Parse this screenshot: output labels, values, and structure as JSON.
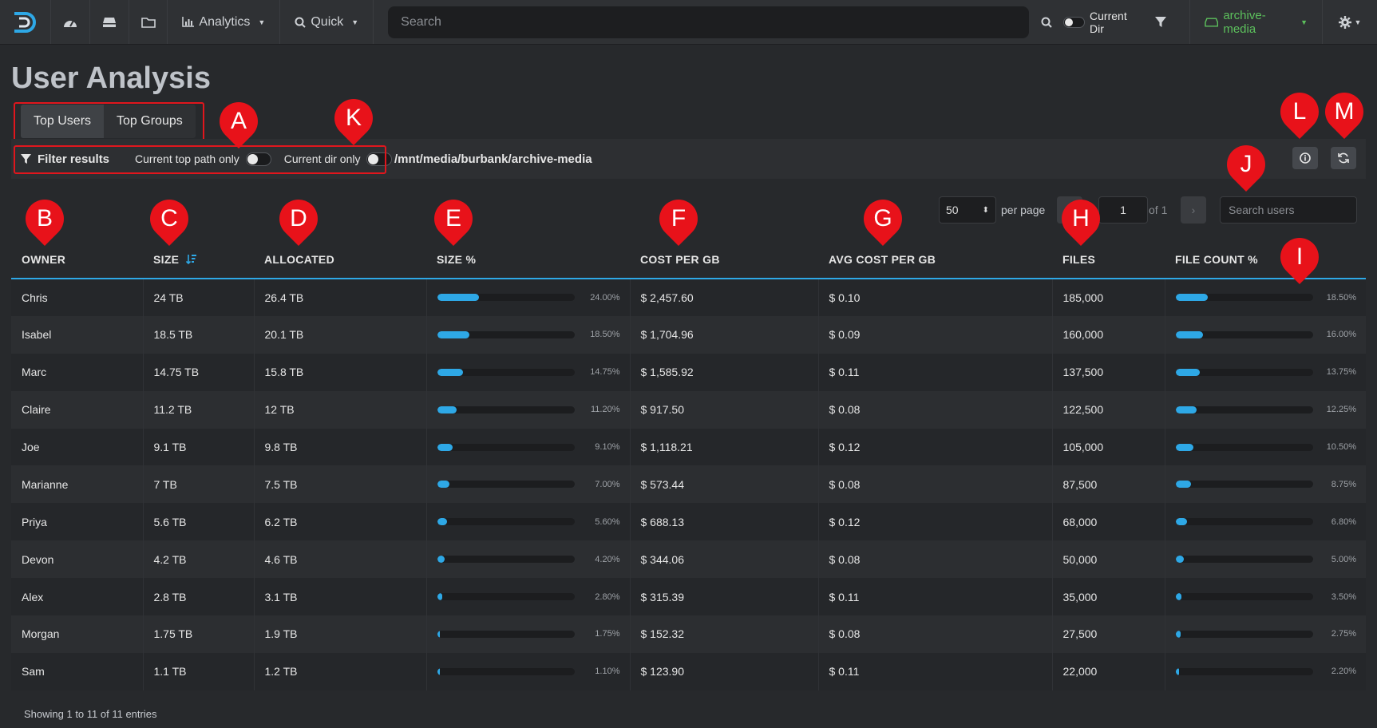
{
  "navbar": {
    "analytics_label": "Analytics",
    "quick_label": "Quick",
    "search_placeholder": "Search",
    "current_dir_label": "Current Dir",
    "archive_label": "archive-media"
  },
  "page": {
    "title": "User Analysis",
    "tabs": [
      {
        "label": "Top Users",
        "active": true
      },
      {
        "label": "Top Groups",
        "active": false
      }
    ]
  },
  "filter": {
    "label": "Filter results",
    "top_path_label": "Current top path only",
    "current_dir_label": "Current dir only",
    "path": "/mnt/media/burbank/archive-media"
  },
  "controls": {
    "per_page_value": "50",
    "per_page_label": "per page",
    "page_value": "1",
    "of_label": "of 1",
    "search_placeholder": "Search users"
  },
  "table": {
    "headers": [
      "OWNER",
      "SIZE",
      "ALLOCATED",
      "SIZE %",
      "COST PER GB",
      "AVG COST PER GB",
      "FILES",
      "FILE COUNT %"
    ],
    "rows": [
      {
        "owner": "Chris",
        "size": "24 TB",
        "allocated": "26.4 TB",
        "size_pct": "24.00%",
        "size_frac": 0.24,
        "cost": "$ 2,457.60",
        "avg": "$ 0.10",
        "files": "185,000",
        "fc_pct": "18.50%",
        "fc_frac": 0.185
      },
      {
        "owner": "Isabel",
        "size": "18.5 TB",
        "allocated": "20.1 TB",
        "size_pct": "18.50%",
        "size_frac": 0.185,
        "cost": "$ 1,704.96",
        "avg": "$ 0.09",
        "files": "160,000",
        "fc_pct": "16.00%",
        "fc_frac": 0.16
      },
      {
        "owner": "Marc",
        "size": "14.75 TB",
        "allocated": "15.8 TB",
        "size_pct": "14.75%",
        "size_frac": 0.1475,
        "cost": "$ 1,585.92",
        "avg": "$ 0.11",
        "files": "137,500",
        "fc_pct": "13.75%",
        "fc_frac": 0.1375
      },
      {
        "owner": "Claire",
        "size": "11.2 TB",
        "allocated": "12 TB",
        "size_pct": "11.20%",
        "size_frac": 0.112,
        "cost": "$ 917.50",
        "avg": "$ 0.08",
        "files": "122,500",
        "fc_pct": "12.25%",
        "fc_frac": 0.1225
      },
      {
        "owner": "Joe",
        "size": "9.1 TB",
        "allocated": "9.8 TB",
        "size_pct": "9.10%",
        "size_frac": 0.091,
        "cost": "$ 1,118.21",
        "avg": "$ 0.12",
        "files": "105,000",
        "fc_pct": "10.50%",
        "fc_frac": 0.105
      },
      {
        "owner": "Marianne",
        "size": "7 TB",
        "allocated": "7.5 TB",
        "size_pct": "7.00%",
        "size_frac": 0.07,
        "cost": "$ 573.44",
        "avg": "$ 0.08",
        "files": "87,500",
        "fc_pct": "8.75%",
        "fc_frac": 0.0875
      },
      {
        "owner": "Priya",
        "size": "5.6 TB",
        "allocated": "6.2 TB",
        "size_pct": "5.60%",
        "size_frac": 0.056,
        "cost": "$ 688.13",
        "avg": "$ 0.12",
        "files": "68,000",
        "fc_pct": "6.80%",
        "fc_frac": 0.068
      },
      {
        "owner": "Devon",
        "size": "4.2 TB",
        "allocated": "4.6 TB",
        "size_pct": "4.20%",
        "size_frac": 0.042,
        "cost": "$ 344.06",
        "avg": "$ 0.08",
        "files": "50,000",
        "fc_pct": "5.00%",
        "fc_frac": 0.05
      },
      {
        "owner": "Alex",
        "size": "2.8 TB",
        "allocated": "3.1 TB",
        "size_pct": "2.80%",
        "size_frac": 0.028,
        "cost": "$ 315.39",
        "avg": "$ 0.11",
        "files": "35,000",
        "fc_pct": "3.50%",
        "fc_frac": 0.035
      },
      {
        "owner": "Morgan",
        "size": "1.75 TB",
        "allocated": "1.9 TB",
        "size_pct": "1.75%",
        "size_frac": 0.0175,
        "cost": "$ 152.32",
        "avg": "$ 0.08",
        "files": "27,500",
        "fc_pct": "2.75%",
        "fc_frac": 0.0275
      },
      {
        "owner": "Sam",
        "size": "1.1 TB",
        "allocated": "1.2 TB",
        "size_pct": "1.10%",
        "size_frac": 0.011,
        "cost": "$ 123.90",
        "avg": "$ 0.11",
        "files": "22,000",
        "fc_pct": "2.20%",
        "fc_frac": 0.022
      }
    ],
    "footer": "Showing 1 to 11 of 11 entries"
  },
  "markers": [
    "A",
    "B",
    "C",
    "D",
    "E",
    "F",
    "G",
    "H",
    "I",
    "J",
    "K",
    "L",
    "M"
  ],
  "colors": {
    "accent": "#2ea8e6",
    "marker": "#e8121a",
    "archive": "#5cc05c"
  }
}
